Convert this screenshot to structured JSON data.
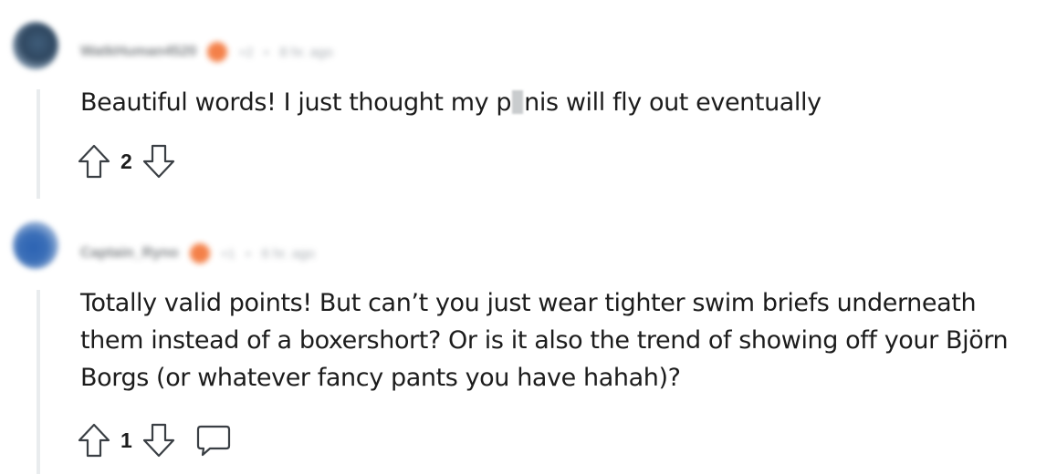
{
  "comments": [
    {
      "username": "WatkHuman4520",
      "meta_dot": "•",
      "score_label": "+2",
      "time": "8 hr. ago",
      "body_before": "Beautiful words! I just thought my p",
      "body_after": "nis will fly out eventually",
      "votes": "2",
      "icons": [
        "upvote-icon",
        "downvote-icon"
      ]
    },
    {
      "username": "Captain_Ryno",
      "meta_dot": "•",
      "score_label": "+1",
      "time": "6 hr. ago",
      "body": "Totally valid points! But can’t you just wear tighter swim briefs underneath them instead of a boxershort? Or is it also the trend of showing off your Björn Borgs (or whatever fancy pants you have hahah)?",
      "votes": "1",
      "icons": [
        "upvote-icon",
        "downvote-icon",
        "reply-icon"
      ]
    }
  ],
  "colors": {
    "thread_line": "#e9ecee",
    "badge": "#f26b2a",
    "text": "#1c1c1c",
    "icon_stroke": "#3a3f44"
  }
}
